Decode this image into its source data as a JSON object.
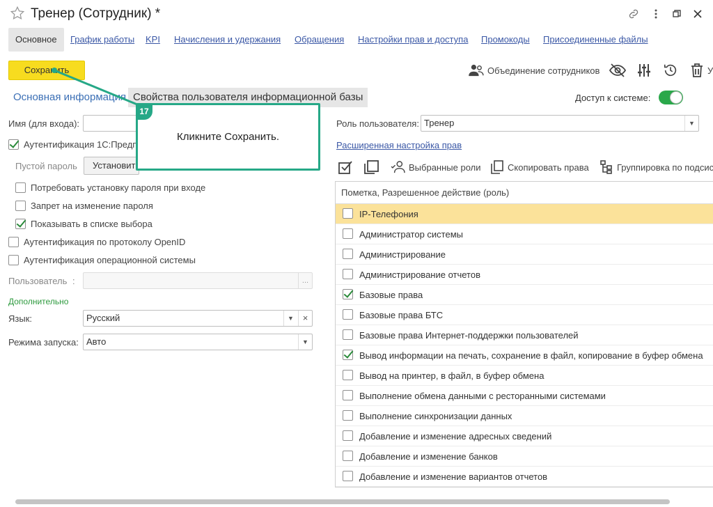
{
  "window": {
    "title": "Тренер (Сотрудник) *"
  },
  "tabs": [
    "Основное",
    "График работы",
    "KPI",
    "Начисления и удержания",
    "Обращения",
    "Настройки прав и доступа",
    "Промокоды",
    "Присоединенные файлы"
  ],
  "toolbar": {
    "save_label": "Сохранить",
    "merge_label": "Объединение сотрудников",
    "cut_letter": "У"
  },
  "subtabs": {
    "main_info": "Основная информация",
    "ib_props": "Свойства пользователя информационной базы"
  },
  "access": {
    "label": "Доступ к системе:",
    "enabled": true
  },
  "form": {
    "login_label": "Имя (для входа):",
    "auth_1c_label": "Аутентификация 1С:Предп",
    "empty_password_label": "Пустой пароль",
    "set_password_button": "Установит",
    "require_password_change": "Потребовать установку пароля при входе",
    "forbid_password_change": "Запрет на изменение пароля",
    "show_in_list": "Показывать в списке выбора",
    "openid_auth": "Аутентификация по протоколу OpenID",
    "os_auth": "Аутентификация операционной системы",
    "user_label": "Пользователь",
    "user_colon": ":",
    "browse_dots": "...",
    "extra_header": "Дополнительно",
    "language_label": "Язык:",
    "language_value": "Русский",
    "clear_glyph": "×",
    "run_mode_label": "Режима запуска:",
    "run_mode_value": "Авто"
  },
  "rights": {
    "role_label": "Роль пользователя:",
    "role_value": "Тренер",
    "advanced_link": "Расширенная настройка прав",
    "selected_roles": "Выбранные роли",
    "copy_rights": "Скопировать права",
    "grouping": "Группировка по подсис",
    "table_header": "Пометка, Разрешенное действие (роль)",
    "roles": [
      {
        "name": "IP-Телефония",
        "checked": false,
        "selected": true
      },
      {
        "name": "Администратор системы",
        "checked": false
      },
      {
        "name": "Администрирование",
        "checked": false
      },
      {
        "name": "Администрирование отчетов",
        "checked": false
      },
      {
        "name": "Базовые права",
        "checked": true
      },
      {
        "name": "Базовые права БТС",
        "checked": false
      },
      {
        "name": "Базовые права Интернет-поддержки пользователей",
        "checked": false
      },
      {
        "name": "Вывод информации на печать, сохранение в файл, копирование в буфер обмена",
        "checked": true
      },
      {
        "name": "Вывод на принтер, в файл, в буфер обмена",
        "checked": false
      },
      {
        "name": "Выполнение обмена данными с ресторанными системами",
        "checked": false
      },
      {
        "name": "Выполнение синхронизации данных",
        "checked": false
      },
      {
        "name": "Добавление и изменение адресных сведений",
        "checked": false
      },
      {
        "name": "Добавление и изменение банков",
        "checked": false
      },
      {
        "name": "Добавление и изменение вариантов отчетов",
        "checked": false
      }
    ]
  },
  "tutorial": {
    "step": "17",
    "text": "Кликните Сохранить."
  },
  "colors": {
    "save": "#f7dc1f",
    "accent": "#26a887",
    "link": "#3b58a6",
    "toggle": "#2aa84a",
    "selected_row": "#fbe29a"
  },
  "icons": [
    "star-icon",
    "link-icon",
    "more-icon",
    "restore-icon",
    "close-icon",
    "people-icon",
    "eye-off-icon",
    "sliders-icon",
    "history-icon",
    "trash-icon"
  ]
}
